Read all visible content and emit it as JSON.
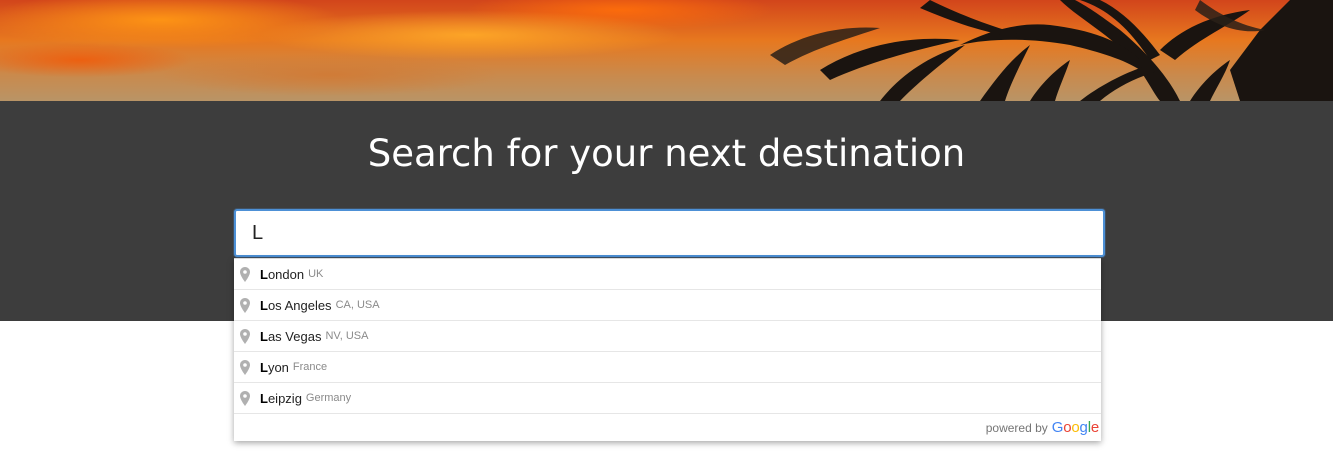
{
  "hero": {
    "image": "sunset-palm-banner"
  },
  "search": {
    "title": "Search for your next destination",
    "value": "L",
    "focus_color": "#4d90d6"
  },
  "autocomplete": {
    "items": [
      {
        "match": "L",
        "rest": "ondon",
        "secondary": "UK",
        "icon": "map-pin-icon"
      },
      {
        "match": "L",
        "rest": "os Angeles",
        "secondary": "CA, USA",
        "icon": "map-pin-icon"
      },
      {
        "match": "L",
        "rest": "as Vegas",
        "secondary": "NV, USA",
        "icon": "map-pin-icon"
      },
      {
        "match": "L",
        "rest": "yon",
        "secondary": "France",
        "icon": "map-pin-icon"
      },
      {
        "match": "L",
        "rest": "eipzig",
        "secondary": "Germany",
        "icon": "map-pin-icon"
      }
    ],
    "powered_by": "powered by",
    "google_letters": [
      {
        "ch": "G",
        "color": "#4285F4"
      },
      {
        "ch": "o",
        "color": "#EA4335"
      },
      {
        "ch": "o",
        "color": "#FBBC05"
      },
      {
        "ch": "g",
        "color": "#4285F4"
      },
      {
        "ch": "l",
        "color": "#34A853"
      },
      {
        "ch": "e",
        "color": "#EA4335"
      }
    ]
  },
  "colors": {
    "band": "#3d3d3d",
    "title_text": "#ffffff"
  }
}
